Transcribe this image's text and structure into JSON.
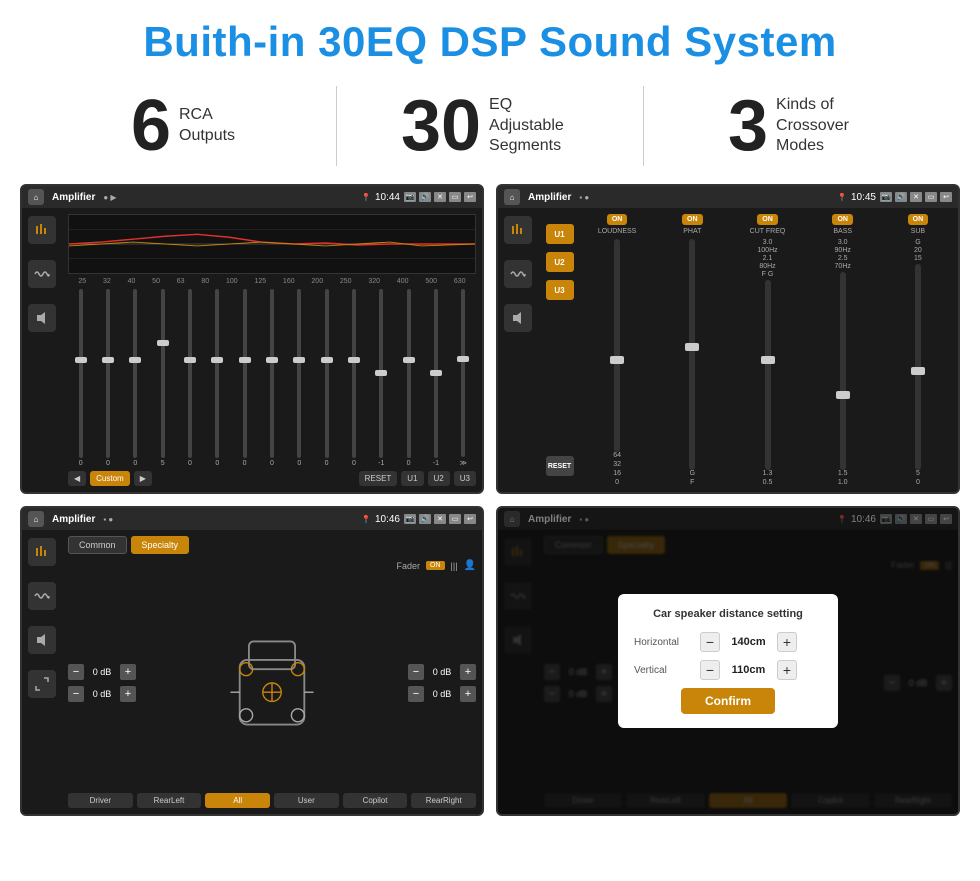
{
  "header": {
    "title": "Buith-in 30EQ DSP Sound System"
  },
  "stats": [
    {
      "number": "6",
      "desc_line1": "RCA",
      "desc_line2": "Outputs"
    },
    {
      "number": "30",
      "desc_line1": "EQ Adjustable",
      "desc_line2": "Segments"
    },
    {
      "number": "3",
      "desc_line1": "Kinds of",
      "desc_line2": "Crossover Modes"
    }
  ],
  "screen1": {
    "app_name": "Amplifier",
    "time": "10:44",
    "freq_labels": [
      "25",
      "32",
      "40",
      "50",
      "63",
      "80",
      "100",
      "125",
      "160",
      "200",
      "250",
      "320",
      "400",
      "500",
      "630"
    ],
    "slider_values": [
      "0",
      "0",
      "0",
      "5",
      "0",
      "0",
      "0",
      "0",
      "0",
      "0",
      "0",
      "-1",
      "0",
      "-1"
    ],
    "nav_buttons": [
      "◀",
      "Custom",
      "▶",
      "RESET",
      "U1",
      "U2",
      "U3"
    ]
  },
  "screen2": {
    "app_name": "Amplifier",
    "time": "10:45",
    "presets": [
      "U1",
      "U2",
      "U3"
    ],
    "channels": [
      {
        "on": true,
        "label": "LOUDNESS"
      },
      {
        "on": true,
        "label": "PHAT"
      },
      {
        "on": true,
        "label": "CUT FREQ"
      },
      {
        "on": true,
        "label": "BASS"
      },
      {
        "on": true,
        "label": "SUB"
      }
    ],
    "reset_label": "RESET"
  },
  "screen3": {
    "app_name": "Amplifier",
    "time": "10:46",
    "tabs": [
      "Common",
      "Specialty"
    ],
    "active_tab": "Specialty",
    "fader_label": "Fader",
    "on_badge": "ON",
    "vol_rows": [
      {
        "value": "0 dB"
      },
      {
        "value": "0 dB"
      },
      {
        "value": "0 dB"
      },
      {
        "value": "0 dB"
      }
    ],
    "nav_buttons": [
      "Driver",
      "RearLeft",
      "All",
      "User",
      "Copilot",
      "RearRight"
    ]
  },
  "screen4": {
    "app_name": "Amplifier",
    "time": "10:46",
    "tabs": [
      "Common",
      "Specialty"
    ],
    "dialog": {
      "title": "Car speaker distance setting",
      "horizontal_label": "Horizontal",
      "horizontal_value": "140cm",
      "vertical_label": "Vertical",
      "vertical_value": "110cm",
      "confirm_label": "Confirm"
    },
    "vol_rows": [
      {
        "value": "0 dB"
      },
      {
        "value": "0 dB"
      }
    ],
    "nav_buttons": [
      "Driver",
      "RearLeft",
      "All",
      "Copilot",
      "RearRight"
    ]
  }
}
